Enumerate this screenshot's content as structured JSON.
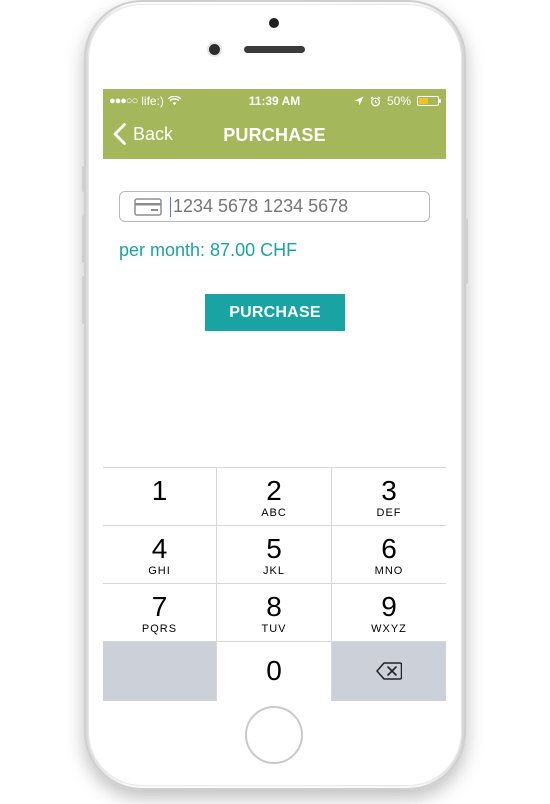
{
  "status_bar": {
    "carrier": "life:)",
    "time": "11:39 AM",
    "battery": "50%",
    "battery_level": 0.5,
    "signal_dots": "●●●○○"
  },
  "nav": {
    "back_label": "Back",
    "title": "PURCHASE"
  },
  "form": {
    "card_placeholder": "1234 5678 1234 5678",
    "per_month": "per month: 87.00 CHF",
    "purchase_button": "PURCHASE"
  },
  "keypad": {
    "keys": [
      {
        "num": "1",
        "letters": ""
      },
      {
        "num": "2",
        "letters": "ABC"
      },
      {
        "num": "3",
        "letters": "DEF"
      },
      {
        "num": "4",
        "letters": "GHI"
      },
      {
        "num": "5",
        "letters": "JKL"
      },
      {
        "num": "6",
        "letters": "MNO"
      },
      {
        "num": "7",
        "letters": "PQRS"
      },
      {
        "num": "8",
        "letters": "TUV"
      },
      {
        "num": "9",
        "letters": "WXYZ"
      },
      {
        "num": "0",
        "letters": ""
      }
    ]
  },
  "colors": {
    "header": "#a4b85b",
    "accent": "#19a3a3"
  }
}
